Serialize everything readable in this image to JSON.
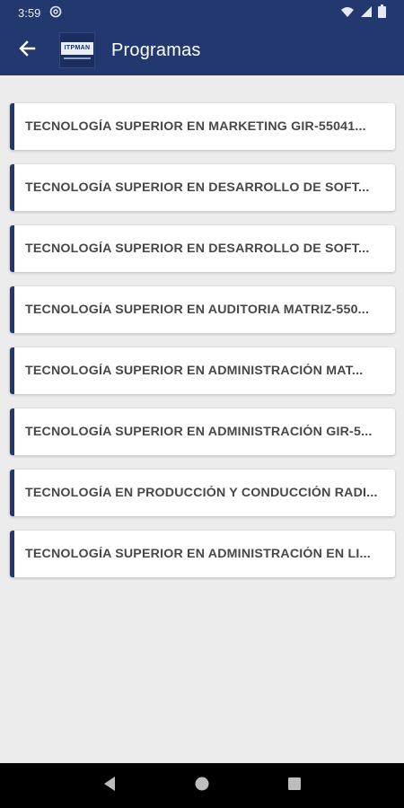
{
  "status_bar": {
    "time": "3:59",
    "icons": [
      "at-sign-icon",
      "wifi-icon",
      "signal-icon",
      "battery-icon"
    ]
  },
  "toolbar": {
    "back_icon": "arrow-left-icon",
    "logo_text": "ITPMAN",
    "title": "Programas"
  },
  "programs": [
    {
      "label": "TECNOLOGÍA SUPERIOR EN MARKETING GIR-55041..."
    },
    {
      "label": "TECNOLOGÍA SUPERIOR EN DESARROLLO DE SOFT..."
    },
    {
      "label": "TECNOLOGÍA SUPERIOR EN DESARROLLO DE SOFT..."
    },
    {
      "label": "TECNOLOGÍA SUPERIOR EN AUDITORIA MATRIZ-550..."
    },
    {
      "label": "TECNOLOGÍA SUPERIOR EN ADMINISTRACIÓN MAT..."
    },
    {
      "label": "TECNOLOGÍA SUPERIOR EN ADMINISTRACIÓN GIR-5..."
    },
    {
      "label": "TECNOLOGÍA EN PRODUCCIÓN Y CONDUCCIÓN RADI..."
    },
    {
      "label": "TECNOLOGÍA  SUPERIOR EN ADMINISTRACIÓN EN LI..."
    }
  ],
  "nav_bar": {
    "icons": [
      "back-triangle-icon",
      "home-circle-icon",
      "recents-square-icon"
    ]
  },
  "colors": {
    "primary": "#22386f",
    "background": "#ececec",
    "card": "#ffffff",
    "text": "#474747"
  }
}
